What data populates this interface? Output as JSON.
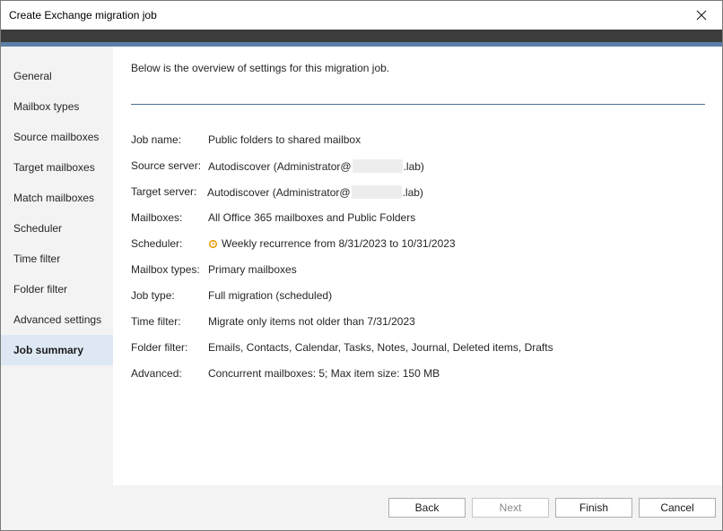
{
  "window": {
    "title": "Create Exchange migration job"
  },
  "sidebar": {
    "items": [
      {
        "label": "General",
        "active": false
      },
      {
        "label": "Mailbox types",
        "active": false
      },
      {
        "label": "Source mailboxes",
        "active": false
      },
      {
        "label": "Target mailboxes",
        "active": false
      },
      {
        "label": "Match mailboxes",
        "active": false
      },
      {
        "label": "Scheduler",
        "active": false
      },
      {
        "label": "Time filter",
        "active": false
      },
      {
        "label": "Folder filter",
        "active": false
      },
      {
        "label": "Advanced settings",
        "active": false
      },
      {
        "label": "Job summary",
        "active": true
      }
    ]
  },
  "main": {
    "intro": "Below is the overview of settings for this migration job.",
    "summary": {
      "job_name": {
        "label": "Job name:",
        "value": "Public folders to shared mailbox"
      },
      "source_server": {
        "label": "Source server:",
        "prefix": "Autodiscover (Administrator@",
        "suffix": ".lab)"
      },
      "target_server": {
        "label": "Target server:",
        "prefix": "Autodiscover (Administrator@",
        "suffix": ".lab)"
      },
      "mailboxes": {
        "label": "Mailboxes:",
        "value": "All Office 365 mailboxes and Public Folders"
      },
      "scheduler": {
        "label": "Scheduler:",
        "value": "Weekly recurrence from 8/31/2023 to 10/31/2023",
        "icon": "clock-icon"
      },
      "mailbox_types": {
        "label": "Mailbox types:",
        "value": "Primary mailboxes"
      },
      "job_type": {
        "label": "Job type:",
        "value": "Full migration (scheduled)"
      },
      "time_filter": {
        "label": "Time filter:",
        "value": "Migrate only items not older than 7/31/2023"
      },
      "folder_filter": {
        "label": "Folder filter:",
        "value": "Emails, Contacts, Calendar, Tasks, Notes, Journal, Deleted items, Drafts"
      },
      "advanced": {
        "label": "Advanced:",
        "value": "Concurrent mailboxes: 5; Max item size: 150 MB"
      }
    }
  },
  "footer": {
    "back": "Back",
    "next": "Next",
    "finish": "Finish",
    "cancel": "Cancel"
  },
  "colors": {
    "accent_bar": "#5b7ea7",
    "dark_bar": "#3c3c3c",
    "sidebar_bg": "#f3f3f3",
    "active_item_bg": "#dde8f4",
    "scheduler_icon": "#e8a317"
  }
}
